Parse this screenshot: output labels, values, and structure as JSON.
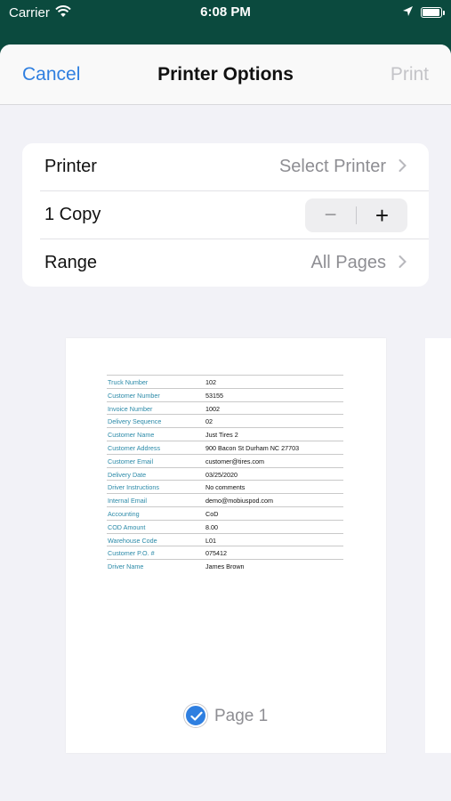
{
  "status_bar": {
    "carrier": "Carrier",
    "time": "6:08 PM"
  },
  "nav": {
    "cancel": "Cancel",
    "title": "Printer Options",
    "print": "Print"
  },
  "options": {
    "printer_label": "Printer",
    "printer_value": "Select Printer",
    "copies_label": "1 Copy",
    "stepper_minus": "−",
    "stepper_plus": "+",
    "range_label": "Range",
    "range_value": "All Pages"
  },
  "preview": {
    "rows": [
      {
        "label": "Truck Number",
        "value": "102"
      },
      {
        "label": "Customer Number",
        "value": "53155"
      },
      {
        "label": "Invoice Number",
        "value": "1002"
      },
      {
        "label": "Delivery Sequence",
        "value": "02"
      },
      {
        "label": "Customer Name",
        "value": "Just Tires 2"
      },
      {
        "label": "Customer Address",
        "value": "900 Bacon St Durham NC 27703"
      },
      {
        "label": "Customer Email",
        "value": "customer@tires.com"
      },
      {
        "label": "Delivery Date",
        "value": "03/25/2020"
      },
      {
        "label": "Driver Instructions",
        "value": "No comments"
      },
      {
        "label": "Internal Email",
        "value": "demo@mobiuspod.com"
      },
      {
        "label": "Accounting",
        "value": "CoD"
      },
      {
        "label": "COD Amount",
        "value": "8.00"
      },
      {
        "label": "Warehouse Code",
        "value": "L01"
      },
      {
        "label": "Customer P.O. #",
        "value": "075412"
      },
      {
        "label": "Driver Name",
        "value": "James Brown"
      }
    ],
    "page_label": "Page 1",
    "page_selected": true
  },
  "colors": {
    "accent": "#2f7fe0",
    "header_bg": "#0b4a3e",
    "doc_label": "#2b8aa8"
  }
}
